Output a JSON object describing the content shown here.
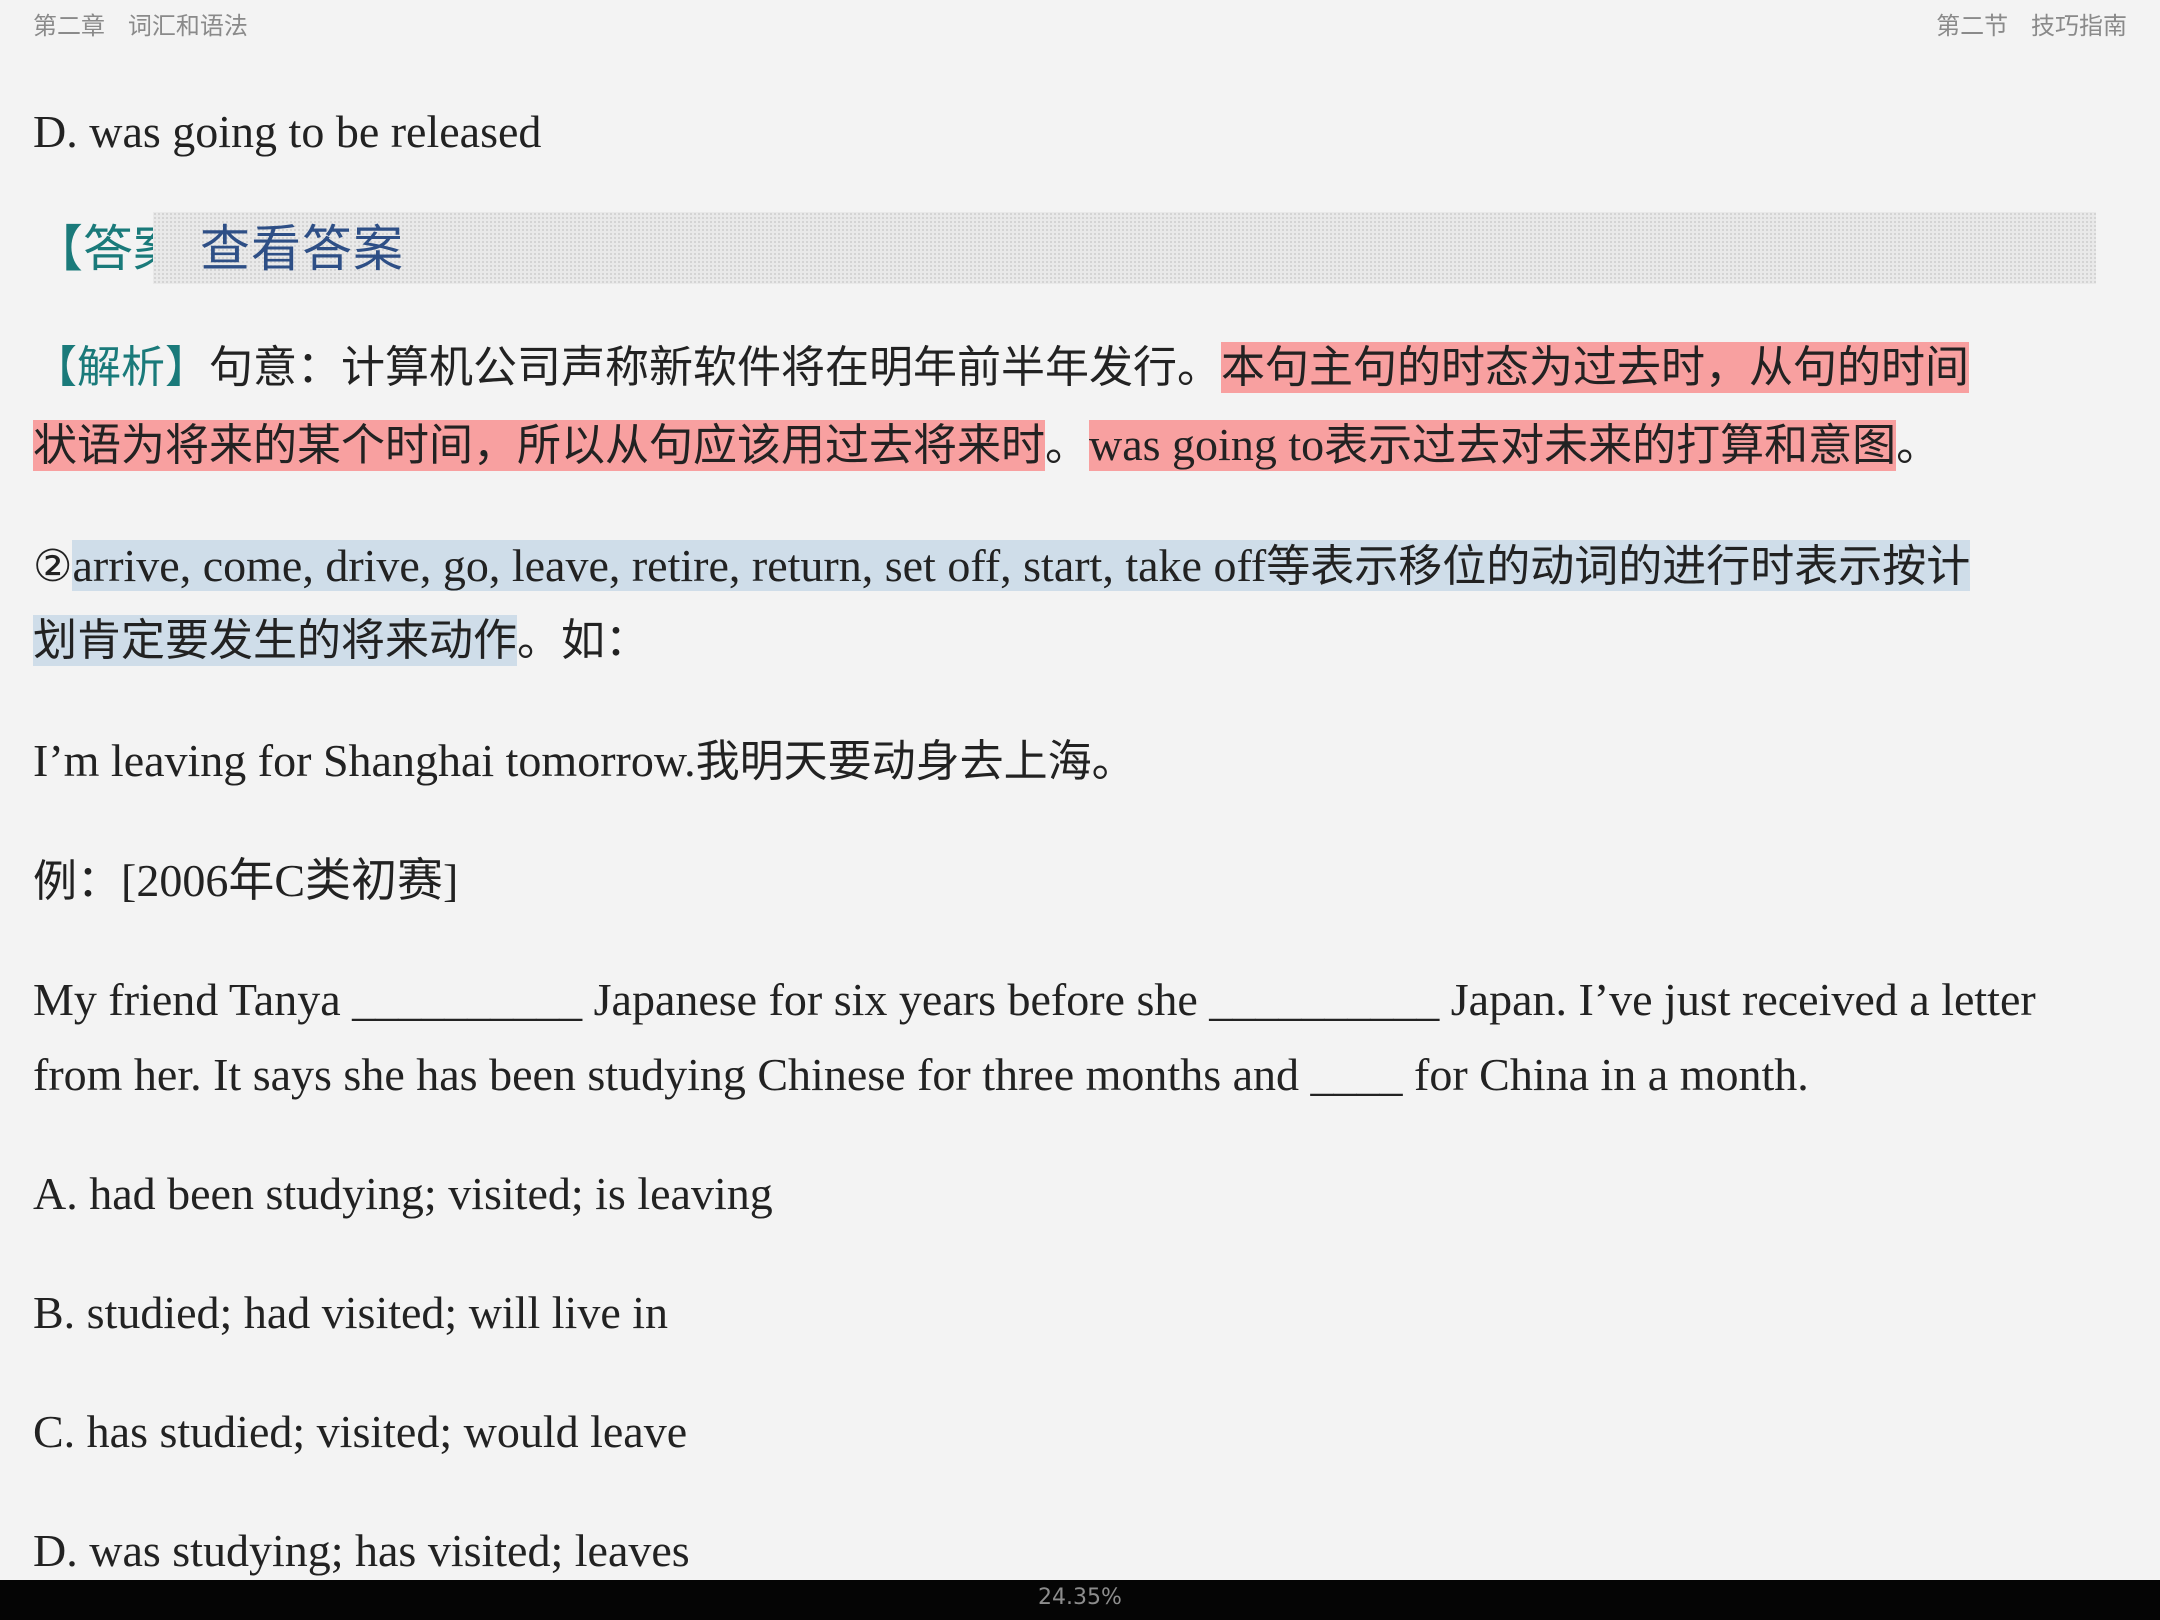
{
  "header": {
    "chapter": "第二章",
    "chapter_title": "词汇和语法",
    "section": "第二节",
    "section_title": "技巧指南"
  },
  "option_prev_d": "D. was going to be released",
  "answer": {
    "tag": "【答案】",
    "reveal_label": "查看答案"
  },
  "analysis": {
    "tag": "【解析】",
    "text_plain": "句意：计算机公司声称新软件将在明年前半年发行。",
    "text_hl_1a": "本句主句的时态为过去时，从句的时间",
    "text_hl_1b": "状语为将来的某个时间，所以从句应该用过去将来时",
    "period_1": "。",
    "text_hl_2_en": "was going to",
    "text_hl_2_zh": "表示过去对未来的打算和意图",
    "period_2": "。"
  },
  "rule": {
    "num": "②",
    "hl_en": "arrive, come, drive, go, leave, retire, return, set off, start, take off",
    "hl_zh_a": "等表示移位的动词的进行时表示按计",
    "hl_zh_b": "划肯定要发生的将来动作",
    "tail": "。如："
  },
  "example_sentence": {
    "en": "I’m leaving for Shanghai tomorrow.",
    "zh": "我明天要动身去上海。"
  },
  "example_label": {
    "zh": "例：",
    "src": "[2006年C类初赛]"
  },
  "question": {
    "line1": "My friend Tanya __________ Japanese for six years before she __________ Japan. I’ve just received a letter",
    "line2": "from her. It says she has been studying Chinese for three months and ____ for China in a month."
  },
  "options": [
    "A. had been studying; visited; is leaving",
    "B. studied; had visited; will live in",
    "C. has studied; visited; would leave",
    "D. was studying; has visited; leaves"
  ],
  "footer": {
    "progress": "24.35%"
  },
  "colors": {
    "tag": "#1a7a7a",
    "highlight_red": "#f8a0a0",
    "highlight_blue": "#cfdde9",
    "link": "#2e4f86"
  }
}
